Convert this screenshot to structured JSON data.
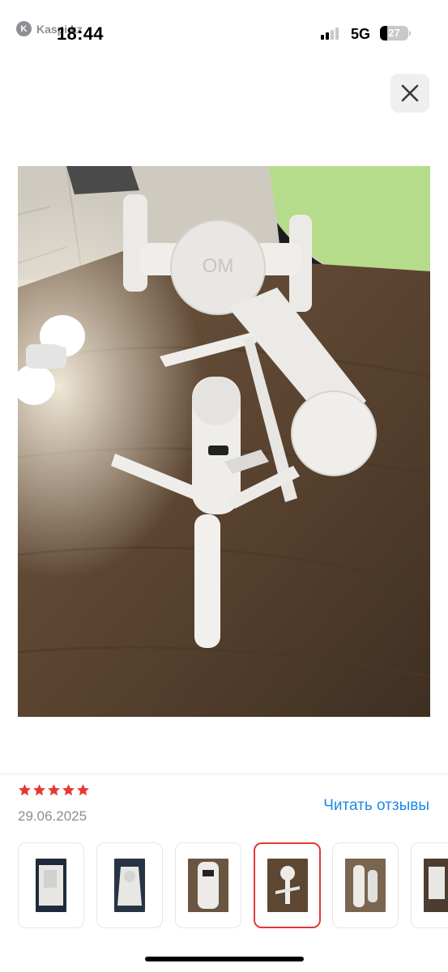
{
  "status_bar": {
    "back_app_name": "Kaspi.kz",
    "back_app_icon": "kaspi-logo-icon",
    "time": "18:44",
    "network": "5G",
    "battery_percent": "27",
    "battery_level": 0.27
  },
  "viewer": {
    "close_icon": "close-icon",
    "photo_alt": "Photo of white phone gimbal on wooden table"
  },
  "review": {
    "rating": 5,
    "star_color": "#e53935",
    "date": "29.06.2025",
    "read_reviews_label": "Читать отзывы",
    "link_color": "#1e88e5"
  },
  "thumbnails": {
    "count": 6,
    "selected_index": 3,
    "selected_border_color": "#e53935"
  }
}
